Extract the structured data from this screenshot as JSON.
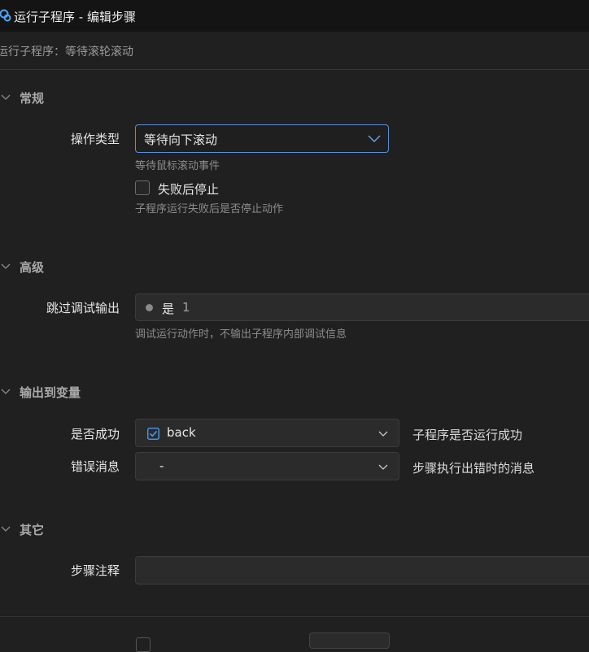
{
  "window": {
    "title": "运行子程序 - 编辑步骤",
    "subtitle": "运行子程序：等待滚轮滚动"
  },
  "sections": {
    "general": {
      "title": "常规",
      "operation_type_label": "操作类型",
      "operation_type_value": "等待向下滚动",
      "operation_type_hint": "等待鼠标滚动事件",
      "stop_on_fail_label": "失败后停止",
      "stop_on_fail_checked": false,
      "stop_on_fail_hint": "子程序运行失败后是否停止动作"
    },
    "advanced": {
      "title": "高级",
      "skip_debug_label": "跳过调试输出",
      "skip_debug_value": "是",
      "skip_debug_number": "1",
      "skip_debug_hint": "调试运行动作时，不输出子程序内部调试信息"
    },
    "output": {
      "title": "输出到变量",
      "success_label": "是否成功",
      "success_value": "back",
      "success_checked": true,
      "success_desc": "子程序是否运行成功",
      "error_label": "错误消息",
      "error_value": "-",
      "error_desc": "步骤执行出错时的消息"
    },
    "other": {
      "title": "其它",
      "comment_label": "步骤注释",
      "comment_value": ""
    }
  },
  "colors": {
    "background": "#202020",
    "titlebar": "#141414",
    "accent": "#5b8fd6",
    "input_bg": "#2b2b2b"
  },
  "icons": {
    "app": "app-logo-icon",
    "section_toggle": "chevron-down-icon",
    "dropdown": "chevron-down-icon",
    "checked": "checkbox-checked-icon"
  }
}
